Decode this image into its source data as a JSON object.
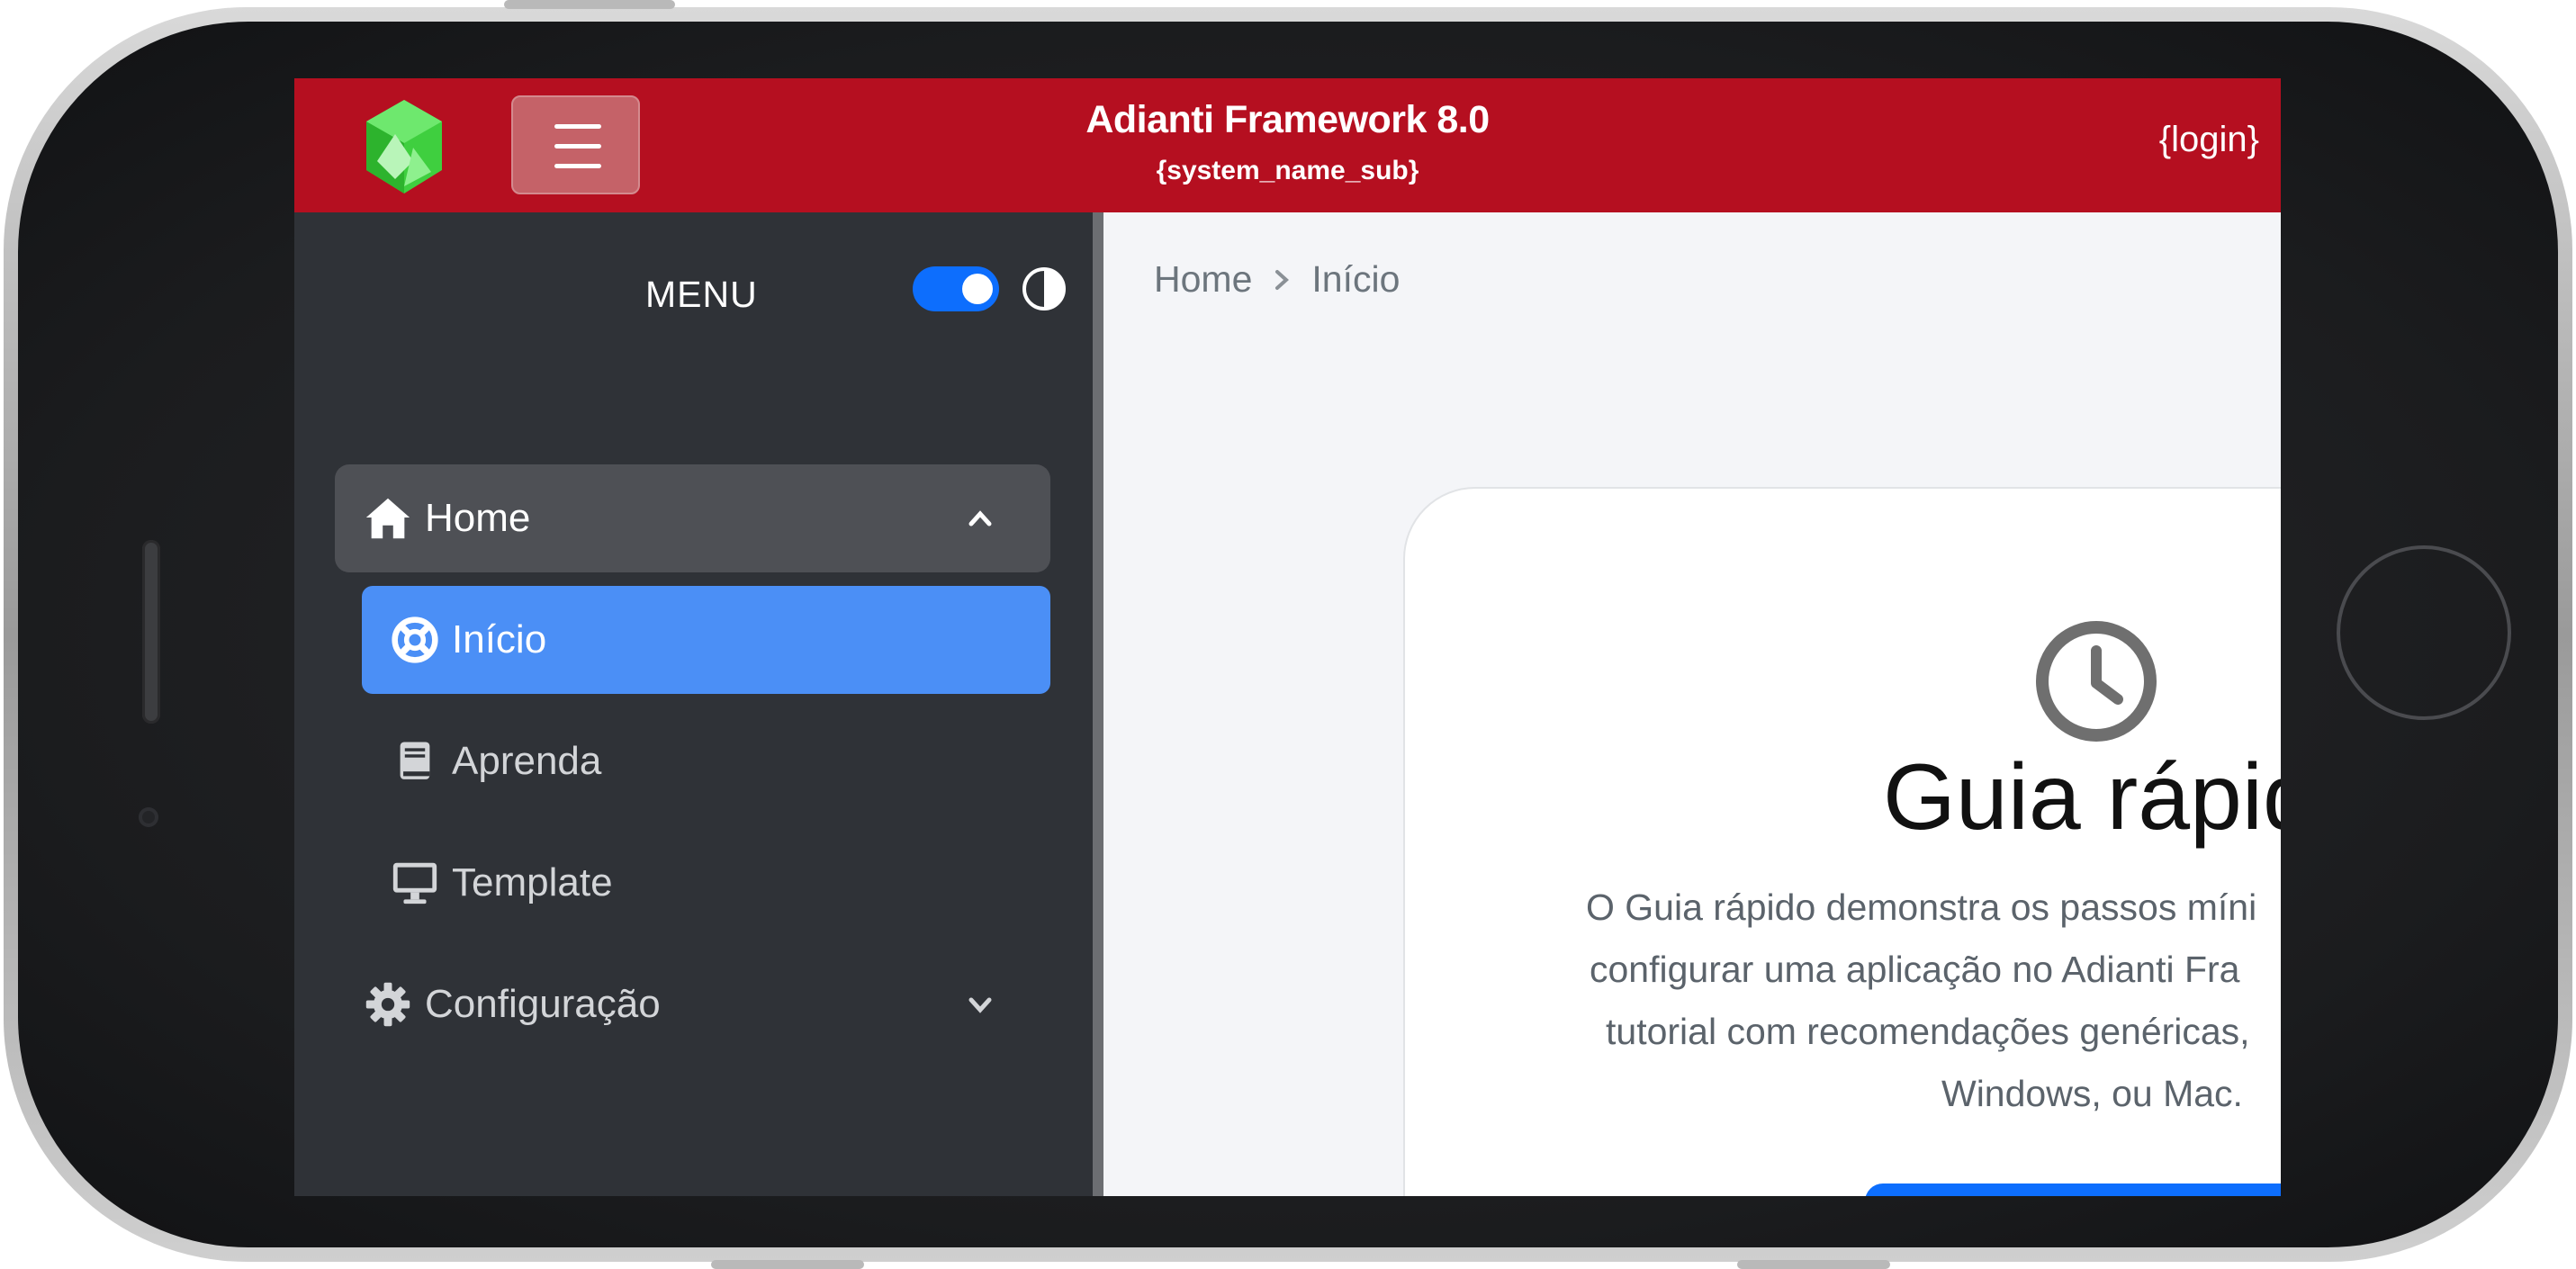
{
  "header": {
    "app_title": "Adianti Framework 8.0",
    "app_subtitle": "{system_name_sub}",
    "login": "{login}"
  },
  "sidebar": {
    "menu_label": "MENU",
    "theme_toggle_on": true,
    "items": [
      {
        "label": "Home",
        "icon": "home-icon",
        "expanded": true,
        "active": false
      },
      {
        "label": "Início",
        "icon": "lifebuoy-icon",
        "active": true
      },
      {
        "label": "Aprenda",
        "icon": "book-icon",
        "active": false
      },
      {
        "label": "Template",
        "icon": "desktop-icon",
        "active": false
      },
      {
        "label": "Configuração",
        "icon": "gear-icon",
        "expanded": false,
        "active": false
      }
    ]
  },
  "breadcrumb": {
    "root": "Home",
    "current": "Início"
  },
  "card": {
    "title": "Guia rápido",
    "description_lines": [
      "O Guia rápido demonstra os passos míni",
      "configurar uma aplicação no Adianti Fra",
      "tutorial com recomendações genéricas,",
      "Windows, ou Mac."
    ]
  },
  "colors": {
    "topbar": "#b50f20",
    "sidebar": "#2f3237",
    "active_item": "#4b8ff6",
    "accent": "#0d6efd"
  }
}
